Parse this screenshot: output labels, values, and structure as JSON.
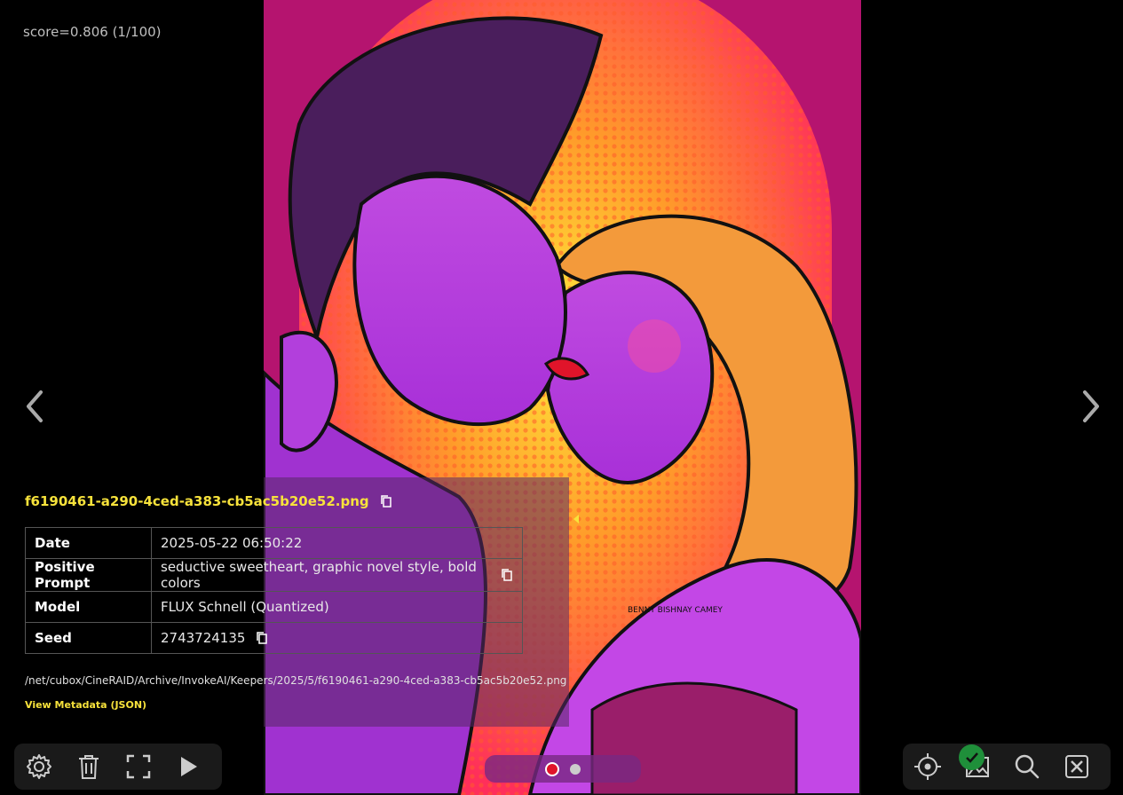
{
  "overlay": {
    "score_text": "score=0.806 (1/100)"
  },
  "artwork": {
    "signature": "BENNY BISHNAY CAMEY"
  },
  "metadata": {
    "filename": "f6190461-a290-4ced-a383-cb5ac5b20e52.png",
    "rows": [
      {
        "key": "Date",
        "value": "2025-05-22 06:50:22"
      },
      {
        "key": "Positive Prompt",
        "value": "seductive sweetheart, graphic novel style, bold colors"
      },
      {
        "key": "Model",
        "value": "FLUX Schnell (Quantized)"
      },
      {
        "key": "Seed",
        "value": "2743724135"
      }
    ],
    "path": "/net/cubox/CineRAID/Archive/InvokeAI/Keepers/2025/5/f6190461-a290-4ced-a383-cb5ac5b20e52.png",
    "metadata_link": "View Metadata (JSON)"
  },
  "toolbar_left": [
    "gear-icon",
    "trash-icon",
    "fullscreen-icon",
    "play-icon"
  ],
  "toolbar_right": [
    "crosshair-icon",
    "image-icon",
    "search-icon",
    "close-square-icon"
  ],
  "pager": {
    "pages": 2,
    "active": 1
  },
  "colors": {
    "accent_yellow": "#f7e23b",
    "badge_green": "#1f8f3a",
    "active_dot": "#e0142a"
  }
}
